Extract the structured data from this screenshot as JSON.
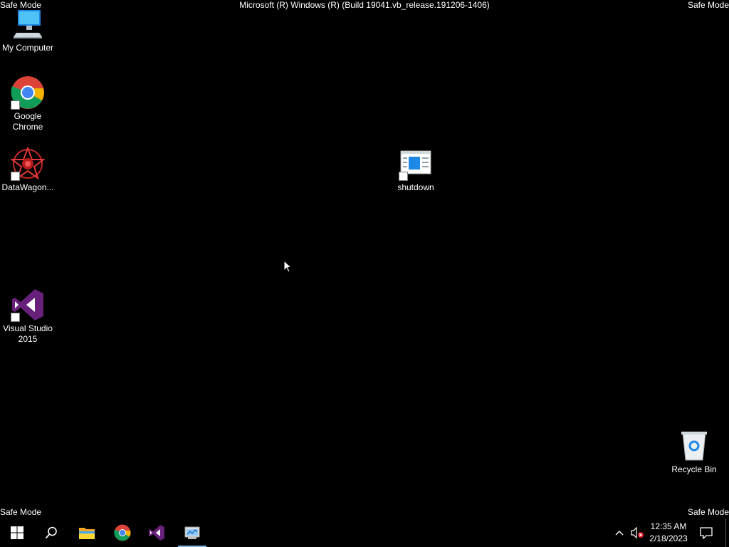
{
  "overlay": {
    "safe_mode_top_left": "Safe Mode",
    "safe_mode_top_right": "Safe Mode",
    "safe_mode_bottom_left": "Safe Mode",
    "safe_mode_bottom_right": "Safe Mode",
    "build_string": "Microsoft (R) Windows (R) (Build 19041.vb_release.191206-1406)"
  },
  "desktop": {
    "icons": {
      "my_computer": {
        "label": "My Computer",
        "icon": "computer-icon"
      },
      "chrome": {
        "label": "Google Chrome",
        "icon": "chrome-icon",
        "shortcut": true
      },
      "datawagon": {
        "label": "DataWagon...",
        "icon": "datawagon-icon",
        "shortcut": true
      },
      "visual_studio": {
        "label": "Visual Studio 2015",
        "icon": "visual-studio-icon",
        "shortcut": true
      },
      "shutdown": {
        "label": "shutdown",
        "icon": "window-app-icon",
        "shortcut": true
      },
      "recycle_bin": {
        "label": "Recycle Bin",
        "icon": "recycle-bin-icon"
      }
    }
  },
  "taskbar": {
    "items": [
      {
        "name": "start-button",
        "icon": "windows-logo-icon"
      },
      {
        "name": "search-button",
        "icon": "search-icon"
      },
      {
        "name": "file-explorer",
        "icon": "folder-icon"
      },
      {
        "name": "chrome",
        "icon": "chrome-icon"
      },
      {
        "name": "visual-studio",
        "icon": "visual-studio-icon"
      },
      {
        "name": "active-app",
        "icon": "app-window-icon",
        "active": true
      }
    ],
    "tray": {
      "time": "12:35 AM",
      "date": "2/18/2023"
    }
  },
  "colors": {
    "background": "#000000",
    "accent": "#7fb4e8",
    "vs_purple": "#68217a"
  }
}
